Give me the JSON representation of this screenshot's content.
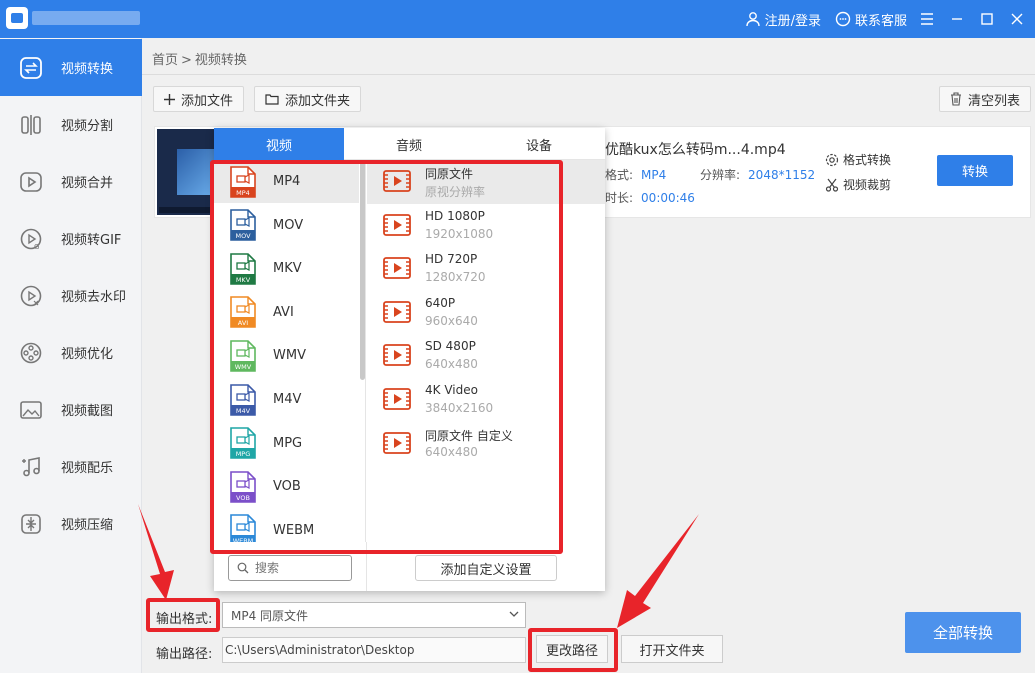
{
  "header": {
    "login_label": "注册/登录",
    "support_label": "联系客服"
  },
  "sidebar": {
    "items": [
      {
        "label": "视频转换",
        "icon": "convert-icon",
        "active": true
      },
      {
        "label": "视频分割",
        "icon": "split-icon"
      },
      {
        "label": "视频合并",
        "icon": "merge-icon"
      },
      {
        "label": "视频转GIF",
        "icon": "gif-icon"
      },
      {
        "label": "视频去水印",
        "icon": "watermark-icon"
      },
      {
        "label": "视频优化",
        "icon": "optimize-icon"
      },
      {
        "label": "视频截图",
        "icon": "screenshot-icon"
      },
      {
        "label": "视频配乐",
        "icon": "music-icon"
      },
      {
        "label": "视频压缩",
        "icon": "compress-icon"
      }
    ]
  },
  "breadcrumb": {
    "home": "首页",
    "separator": ">",
    "current": "视频转换"
  },
  "toolbar": {
    "add_file": "添加文件",
    "add_folder": "添加文件夹",
    "clear_list": "清空列表"
  },
  "file": {
    "name": "优酷kux怎么转码m...4.mp4",
    "format_label": "格式:",
    "format_value": "MP4",
    "resolution_label": "分辨率:",
    "resolution_value": "2048*1152",
    "duration_label": "时长:",
    "duration_value": "00:00:46",
    "format_convert": "格式转换",
    "video_cut": "视频裁剪",
    "convert_button": "转换"
  },
  "popup": {
    "tabs": [
      "视频",
      "音频",
      "设备"
    ],
    "formats": [
      {
        "name": "MP4",
        "color": "#d9441e"
      },
      {
        "name": "MOV",
        "color": "#2c5f9e"
      },
      {
        "name": "MKV",
        "color": "#1f7a44"
      },
      {
        "name": "AVI",
        "color": "#f08a24"
      },
      {
        "name": "WMV",
        "color": "#5fb85f"
      },
      {
        "name": "M4V",
        "color": "#3c5aa8"
      },
      {
        "name": "MPG",
        "color": "#1fa6a6"
      },
      {
        "name": "VOB",
        "color": "#7b4fc9"
      },
      {
        "name": "WEBM",
        "color": "#2c89d8"
      }
    ],
    "qualities": [
      {
        "name": "同原文件",
        "res": "原视分辨率"
      },
      {
        "name": "HD 1080P",
        "res": "1920x1080"
      },
      {
        "name": "HD 720P",
        "res": "1280x720"
      },
      {
        "name": "640P",
        "res": "960x640"
      },
      {
        "name": "SD 480P",
        "res": "640x480"
      },
      {
        "name": "4K Video",
        "res": "3840x2160"
      },
      {
        "name": "同原文件 自定义",
        "res": "640x480"
      }
    ],
    "search_placeholder": "搜索",
    "add_custom": "添加自定义设置"
  },
  "bottom": {
    "output_format_label": "输出格式:",
    "output_format_value": "MP4  同原文件",
    "output_path_label": "输出路径:",
    "output_path_value": "C:\\Users\\Administrator\\Desktop",
    "change_path": "更改路径",
    "open_folder": "打开文件夹",
    "convert_all": "全部转换"
  },
  "colors": {
    "primary": "#2f7fe8",
    "annotation_red": "#e8242a"
  }
}
